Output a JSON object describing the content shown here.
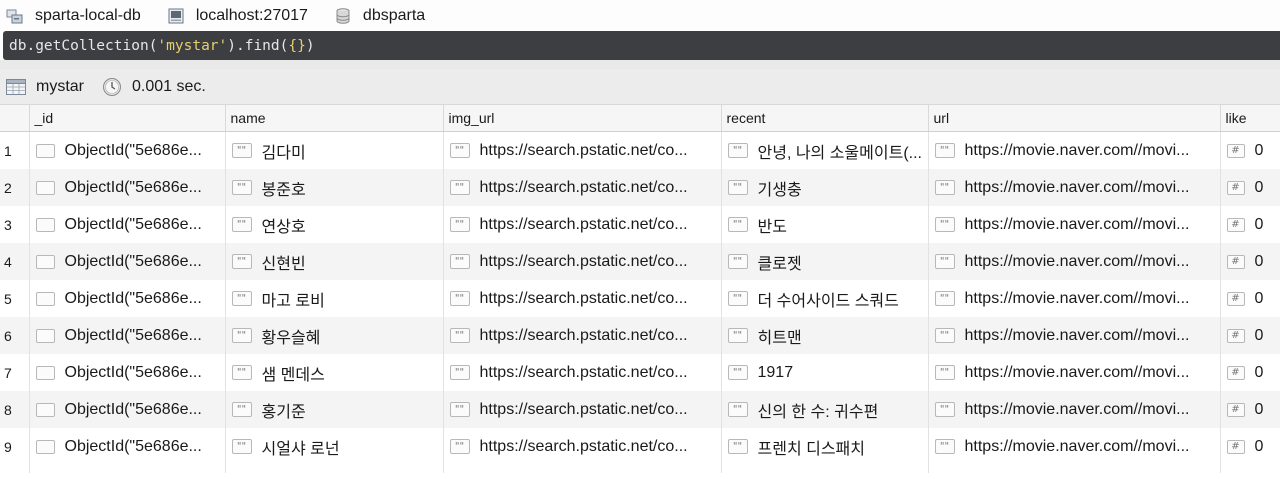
{
  "connection": {
    "name": "sparta-local-db",
    "host": "localhost:27017",
    "database": "dbsparta"
  },
  "query": {
    "prefix": "db",
    "method1": "getCollection(",
    "collection": "'mystar'",
    "method2": ").find(",
    "arg": "{}",
    "suffix": ")"
  },
  "result": {
    "collection": "mystar",
    "time": "0.001 sec."
  },
  "columns": [
    "_id",
    "name",
    "img_url",
    "recent",
    "url",
    "like"
  ],
  "icons": {
    "string_type": "\"\"",
    "number_type": "#"
  },
  "rows": [
    {
      "num": "1",
      "id": "ObjectId(\"5e686e...",
      "name": "김다미",
      "img_url": "https://search.pstatic.net/co...",
      "recent": "안녕, 나의 소울메이트(...",
      "url": "https://movie.naver.com//movi...",
      "like": "0"
    },
    {
      "num": "2",
      "id": "ObjectId(\"5e686e...",
      "name": "봉준호",
      "img_url": "https://search.pstatic.net/co...",
      "recent": "기생충",
      "url": "https://movie.naver.com//movi...",
      "like": "0"
    },
    {
      "num": "3",
      "id": "ObjectId(\"5e686e...",
      "name": "연상호",
      "img_url": "https://search.pstatic.net/co...",
      "recent": "반도",
      "url": "https://movie.naver.com//movi...",
      "like": "0"
    },
    {
      "num": "4",
      "id": "ObjectId(\"5e686e...",
      "name": "신현빈",
      "img_url": "https://search.pstatic.net/co...",
      "recent": "클로젯",
      "url": "https://movie.naver.com//movi...",
      "like": "0"
    },
    {
      "num": "5",
      "id": "ObjectId(\"5e686e...",
      "name": "마고 로비",
      "img_url": "https://search.pstatic.net/co...",
      "recent": "더 수어사이드 스쿼드",
      "url": "https://movie.naver.com//movi...",
      "like": "0"
    },
    {
      "num": "6",
      "id": "ObjectId(\"5e686e...",
      "name": "황우슬혜",
      "img_url": "https://search.pstatic.net/co...",
      "recent": "히트맨",
      "url": "https://movie.naver.com//movi...",
      "like": "0"
    },
    {
      "num": "7",
      "id": "ObjectId(\"5e686e...",
      "name": "샘 멘데스",
      "img_url": "https://search.pstatic.net/co...",
      "recent": "1917",
      "url": "https://movie.naver.com//movi...",
      "like": "0"
    },
    {
      "num": "8",
      "id": "ObjectId(\"5e686e...",
      "name": "홍기준",
      "img_url": "https://search.pstatic.net/co...",
      "recent": "신의 한 수: 귀수편",
      "url": "https://movie.naver.com//movi...",
      "like": "0"
    },
    {
      "num": "9",
      "id": "ObjectId(\"5e686e...",
      "name": "시얼샤 로넌",
      "img_url": "https://search.pstatic.net/co...",
      "recent": "프렌치 디스패치",
      "url": "https://movie.naver.com//movi...",
      "like": "0"
    }
  ]
}
